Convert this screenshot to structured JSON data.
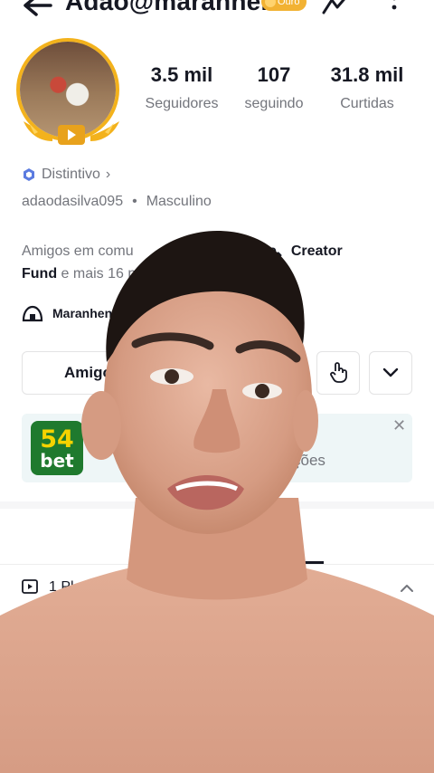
{
  "header": {
    "username": "Adão@maranhens",
    "badge": "Ouro"
  },
  "stats": [
    {
      "value": "3.5 mil",
      "label": "Seguidores"
    },
    {
      "value": "107",
      "label": "seguindo"
    },
    {
      "value": "31.8 mil",
      "label": "Curtidas"
    }
  ],
  "profile": {
    "distintivo": "Distintivo",
    "handle": "adaodasilva095",
    "dot": "•",
    "gender": "Masculino",
    "friends_prefix": "Amigos em comu",
    "friends_hl1": "hense、Creator",
    "friends_hl2": "Fund",
    "friends_suffix": " e mais 16 p",
    "community": "Maranhens"
  },
  "buttons": {
    "friends": "Amigo"
  },
  "ad": {
    "logo_num": "54",
    "logo_text": "bet",
    "text": "ções",
    "close": "✕"
  },
  "playlist": {
    "label": "1 Pl"
  },
  "colors": {
    "text_primary": "#161823",
    "text_secondary": "#73757c",
    "badge_gold": "#f2b233",
    "distintivo_blue": "#5b7be0",
    "ad_bg": "#eef6f7",
    "logo_green": "#1f7a2e",
    "logo_yellow": "#f5d300"
  }
}
